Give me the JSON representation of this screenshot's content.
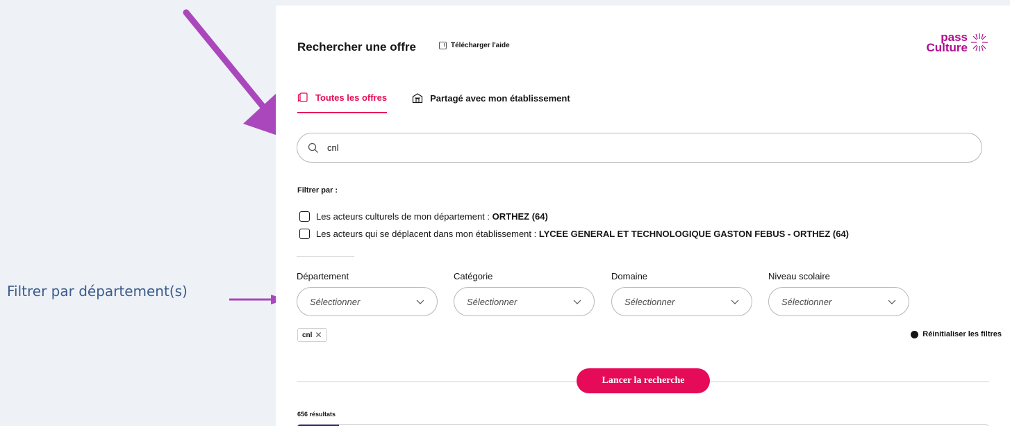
{
  "annotation": {
    "label": "Filtrer par département(s)",
    "arrow_color": "#ab47bc"
  },
  "header": {
    "title": "Rechercher une offre",
    "help_link": "Télécharger l'aide",
    "logo": {
      "line1": "pass",
      "line2": "Culture",
      "color": "#b10b8f"
    }
  },
  "tabs": [
    {
      "label": "Toutes les offres",
      "active": true,
      "icon": "book-icon"
    },
    {
      "label": "Partagé avec mon établissement",
      "active": false,
      "icon": "school-icon"
    }
  ],
  "search": {
    "value": "cnl",
    "icon": "search-icon"
  },
  "filters": {
    "title": "Filtrer par :",
    "checkboxes": [
      {
        "text": "Les acteurs culturels de mon département : ",
        "strong": "ORTHEZ (64)",
        "checked": false
      },
      {
        "text": "Les acteurs qui se déplacent dans mon établissement : ",
        "strong": "LYCEE GENERAL ET TECHNOLOGIQUE GASTON FEBUS - ORTHEZ (64)",
        "checked": false
      }
    ],
    "selects": [
      {
        "label": "Département",
        "placeholder": "Sélectionner"
      },
      {
        "label": "Catégorie",
        "placeholder": "Sélectionner"
      },
      {
        "label": "Domaine",
        "placeholder": "Sélectionner"
      },
      {
        "label": "Niveau scolaire",
        "placeholder": "Sélectionner"
      }
    ],
    "active_tag": "cnl",
    "reset_label": "Réinitialiser les filtres"
  },
  "launch_button": "Lancer la recherche",
  "results_count": "656 résultats",
  "accent_color": "#e60b58"
}
